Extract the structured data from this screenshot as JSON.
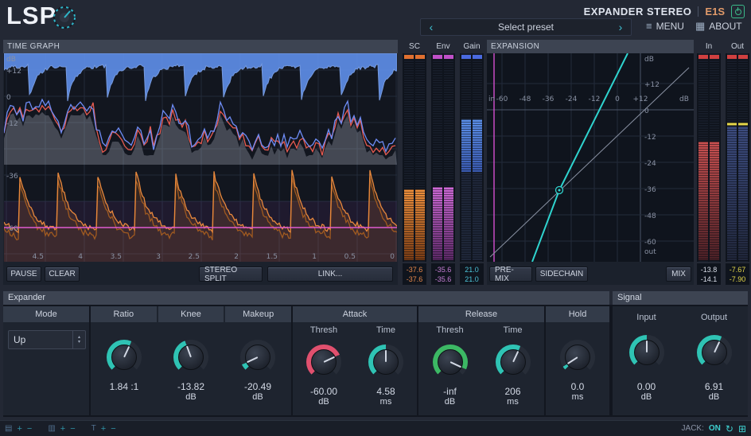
{
  "header": {
    "logo_text": "LSP",
    "title": "EXPANDER STEREO",
    "plugin_code": "E1S"
  },
  "preset_bar": {
    "preset_label": "Select preset",
    "menu_label": "MENU",
    "about_label": "ABOUT"
  },
  "icons": {
    "prev": "‹",
    "next": "›",
    "menu": "≡",
    "about": "▦",
    "spin_up": "▴",
    "spin_down": "▾",
    "refresh": "↻",
    "window": "⊞",
    "zoom_icons": [
      "▤",
      "▥",
      "T"
    ],
    "zoom_in": "+",
    "zoom_out": "−"
  },
  "time_graph": {
    "title": "TIME GRAPH",
    "unit_label": "dB",
    "y_ticks": [
      "+12",
      "0",
      "-12",
      "-36",
      "-60"
    ],
    "x_ticks": [
      "4.5",
      "4",
      "3.5",
      "3",
      "2.5",
      "2",
      "1.5",
      "1",
      "0.5",
      "0"
    ],
    "pause_label": "PAUSE",
    "clear_label": "CLEAR",
    "stereo_split_label": "STEREO SPLIT",
    "link_label": "LINK..."
  },
  "meters": {
    "sc": {
      "label": "SC",
      "value_l": "-37.6",
      "value_r": "-37.6",
      "color": "#e6874a"
    },
    "env": {
      "label": "Env",
      "value_l": "-35.6",
      "value_r": "-35.6",
      "color": "#c77fd6"
    },
    "gain": {
      "label": "Gain",
      "value_l": "21.0",
      "value_r": "21.0",
      "color": "#4cc3d8"
    },
    "in": {
      "label": "In",
      "value_l": "-13.8",
      "value_r": "-14.1",
      "color": "#d8dde8"
    },
    "out": {
      "label": "Out",
      "value_l": "-7.67",
      "value_r": "-7.90",
      "color": "#e6d84a"
    }
  },
  "expansion": {
    "title": "EXPANSION",
    "x_axis_label_left": "in",
    "x_ticks": [
      "-60",
      "-48",
      "-36",
      "-24",
      "-12",
      "0",
      "+12"
    ],
    "x_unit": "dB",
    "y_unit": "dB",
    "y_ticks": [
      "+12",
      "0",
      "-12",
      "-24",
      "-36",
      "-48",
      "-60"
    ],
    "y_axis_label_bottom": "out",
    "premix_label": "PRE-MIX",
    "sidechain_label": "SIDECHAIN",
    "mix_label": "MIX",
    "curve_color": "#2fd4cf",
    "threshold_color": "#d44fd0"
  },
  "expander_section": {
    "title": "Expander",
    "mode": {
      "label": "Mode",
      "value": "Up"
    },
    "ratio": {
      "label": "Ratio",
      "value": "1.84 :1",
      "unit": "",
      "arc_deg": 160,
      "color": "#2fc3b4"
    },
    "knee": {
      "label": "Knee",
      "value": "-13.82",
      "unit": "dB",
      "arc_deg": 115,
      "color": "#2fc3b4"
    },
    "makeup": {
      "label": "Makeup",
      "value": "-20.49",
      "unit": "dB",
      "arc_deg": 20,
      "color": "#2fc3b4"
    },
    "attack": {
      "title": "Attack",
      "thresh": {
        "label": "Thresh",
        "value": "-60.00",
        "unit": "dB",
        "arc_deg": 200,
        "color": "#e0506e"
      },
      "time": {
        "label": "Time",
        "value": "4.58",
        "unit": "ms",
        "arc_deg": 135,
        "color": "#2fc3b4"
      }
    },
    "release": {
      "title": "Release",
      "thresh": {
        "label": "Thresh",
        "value": "-inf",
        "unit": "dB",
        "arc_deg": 250,
        "color": "#3cb864"
      },
      "time": {
        "label": "Time",
        "value": "206",
        "unit": "ms",
        "arc_deg": 160,
        "color": "#2fc3b4"
      }
    },
    "hold": {
      "title": "Hold",
      "knob": {
        "value": "0.0",
        "unit": "ms",
        "arc_deg": 12,
        "color": "#2fc3b4"
      }
    }
  },
  "signal_section": {
    "title": "Signal",
    "input": {
      "label": "Input",
      "value": "0.00",
      "unit": "dB",
      "arc_deg": 135,
      "color": "#2fc3b4"
    },
    "output": {
      "label": "Output",
      "value": "6.91",
      "unit": "dB",
      "arc_deg": 160,
      "color": "#2fc3b4"
    }
  },
  "status_bar": {
    "jack_label": "JACK:",
    "jack_state": "ON"
  }
}
